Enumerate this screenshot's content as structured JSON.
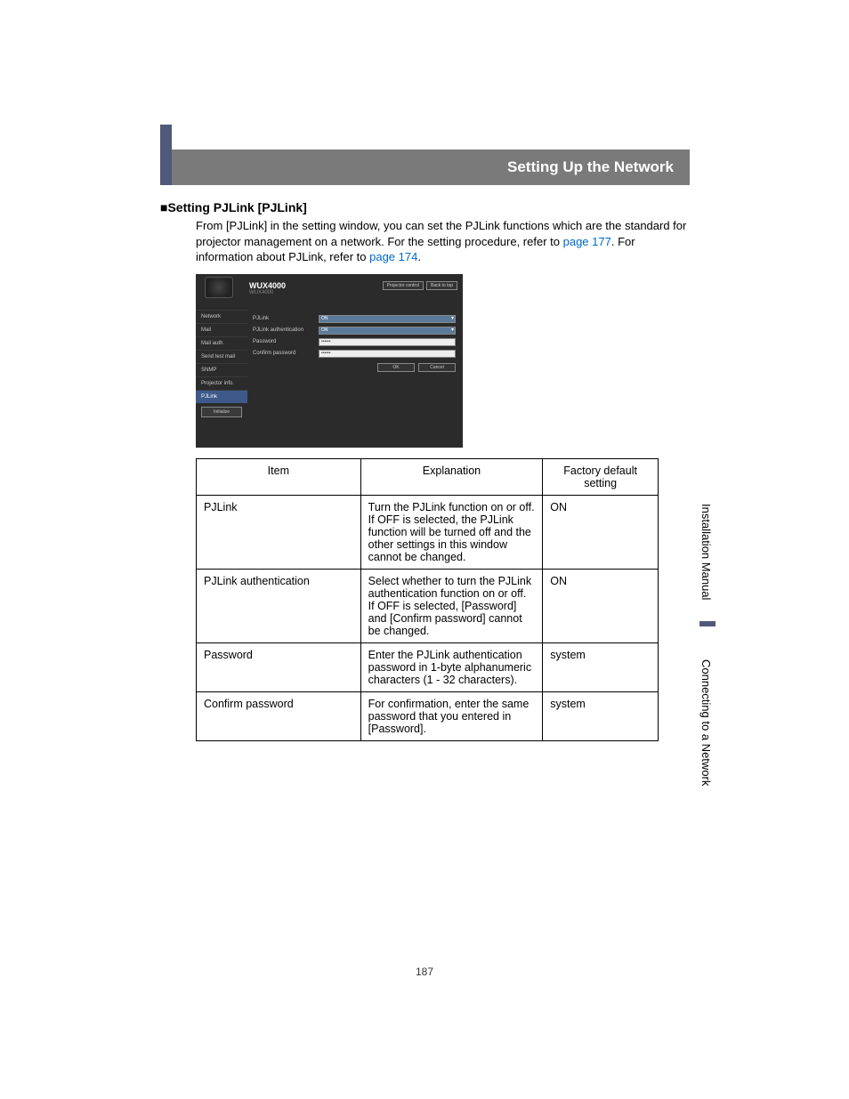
{
  "header": {
    "title": "Setting Up the Network"
  },
  "section": {
    "bullet": "■",
    "heading": "Setting PJLink [PJLink]",
    "intro_1": "From [PJLink] in the setting window, you can set the PJLink functions which are the standard for projector management on a network. For the setting procedure, refer to ",
    "link1": "page 177",
    "intro_2": ". For information about PJLink, refer to ",
    "link2": "page 174",
    "intro_3": "."
  },
  "screenshot": {
    "title": "WUX4000",
    "subtitle": "WUX4000",
    "top_buttons": {
      "projector_control": "Projector control",
      "back_to_top": "Back to top"
    },
    "side": {
      "items": [
        "Network",
        "Mail",
        "Mail auth.",
        "Send test mail",
        "SNMP",
        "Projector info.",
        "PJLink"
      ],
      "init": "Initialize"
    },
    "rows": {
      "pjlink": {
        "label": "PJLink",
        "value": "ON"
      },
      "auth": {
        "label": "PJLink authentication",
        "value": "ON"
      },
      "password": {
        "label": "Password",
        "value": "••••••"
      },
      "confirm": {
        "label": "Confirm password",
        "value": "••••••"
      }
    },
    "buttons": {
      "ok": "OK",
      "cancel": "Cancel"
    }
  },
  "table": {
    "headers": {
      "item": "Item",
      "explanation": "Explanation",
      "default": "Factory default setting"
    },
    "rows": [
      {
        "item": "PJLink",
        "explanation": "Turn the PJLink function on or off. If OFF is selected, the PJLink function will be turned off and the other settings in this window cannot be changed.",
        "default": "ON"
      },
      {
        "item": "PJLink authentication",
        "explanation": "Select whether to turn the PJLink authentication function on or off. If OFF is selected, [Password] and [Confirm password] cannot be changed.",
        "default": "ON"
      },
      {
        "item": "Password",
        "explanation": "Enter the PJLink authentication password in 1-byte alphanumeric characters (1 - 32 characters).",
        "default": "system"
      },
      {
        "item": "Confirm password",
        "explanation": "For confirmation, enter the same password that you entered in [Password].",
        "default": "system"
      }
    ]
  },
  "side_tabs": {
    "tab1": "Installation Manual",
    "tab2": "Connecting to a Network"
  },
  "page_number": "187"
}
